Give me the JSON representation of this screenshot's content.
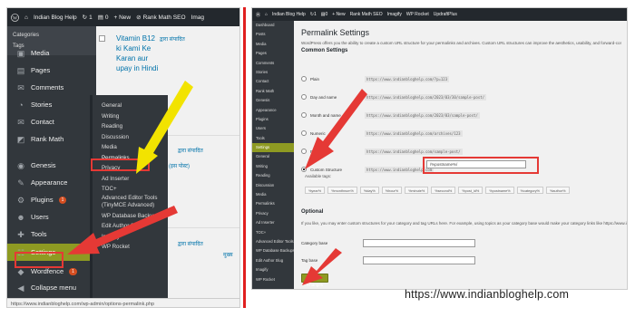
{
  "left": {
    "adminbar": {
      "wp_logo": "wordpress-logo-icon",
      "site_name": "Indian Blog Help",
      "updates_count": "1",
      "comments_count": "0",
      "new_label": "+ New",
      "rankmath_label": "Rank Math SEO",
      "more_label": "Imag"
    },
    "sidebar_top": [
      "Categories",
      "Tags"
    ],
    "menu": [
      {
        "label": "Media",
        "icon": "media-icon"
      },
      {
        "label": "Pages",
        "icon": "pages-icon"
      },
      {
        "label": "Comments",
        "icon": "comments-icon"
      },
      {
        "label": "Stories",
        "icon": "stories-icon"
      },
      {
        "label": "Contact",
        "icon": "contact-icon"
      },
      {
        "label": "Rank Math",
        "icon": "rankmath-icon"
      },
      {
        "label": "Genesis",
        "icon": "genesis-icon"
      },
      {
        "label": "Appearance",
        "icon": "appearance-icon"
      },
      {
        "label": "Plugins",
        "icon": "plugins-icon",
        "badge": "1"
      },
      {
        "label": "Users",
        "icon": "users-icon"
      },
      {
        "label": "Tools",
        "icon": "tools-icon"
      },
      {
        "label": "Settings",
        "icon": "settings-icon",
        "active": true
      },
      {
        "label": "Wordfence",
        "icon": "wordfence-icon",
        "badge": "1"
      },
      {
        "label": "Collapse menu",
        "icon": "collapse-icon"
      }
    ],
    "flyout": [
      "General",
      "Writing",
      "Reading",
      "Discussion",
      "Media",
      "Permalinks",
      "Privacy",
      "Ad Inserter",
      "TOC+",
      "Advanced Editor Tools (TinyMCE Advanced)",
      "WP Database Backups",
      "Edit Author Slug",
      "Imagify",
      "WP Rocket"
    ],
    "posts": {
      "post1_line1": "Vitamin B12",
      "post1_line2": "ki Kami Ke",
      "post1_line3": "Karan aur",
      "post1_line4": "upay in Hindi",
      "hindi1": "द्वारा संपादित",
      "hindi2": "द्वारा संपादित",
      "hindi3": "(इस पोस्ट)",
      "hindi4": "द्वारा संपादित",
      "hindi5": "मुख्य"
    },
    "statusbar": "https://www.indianbloghelp.com/wp-admin/options-permalink.php"
  },
  "right": {
    "adminbar": {
      "site_name": "Indian Blog Help",
      "updates_count": "1",
      "comments_count": "0",
      "new_label": "+ New",
      "rankmath_label": "Rank Math SEO",
      "imagify_label": "Imagify",
      "wprocket_label": "WP Rocket",
      "updraft_label": "UpdraftPlus"
    },
    "sidebar": [
      "Dashboard",
      "Posts",
      "Media",
      "Pages",
      "Comments",
      "Stories",
      "Contact",
      "Rank Math",
      "Genesis",
      "Appearance",
      "Plugins",
      "Users",
      "Tools",
      "Settings",
      "General",
      "Writing",
      "Reading",
      "Discussion",
      "Media",
      "Permalinks",
      "Privacy",
      "Ad Inserter",
      "TOC+",
      "Advanced Editor Tools",
      "WP Database Backups",
      "Edit Author Slug",
      "Imagify",
      "WP Rocket"
    ],
    "title": "Permalink Settings",
    "intro": "WordPress offers you the ability to create a custom URL structure for your permalinks and archives. Custom URL structures can improve the aesthetics, usability, and forward-compatibility of your links.",
    "common_heading": "Common Settings",
    "options": [
      {
        "label": "Plain",
        "code": "https://www.indianbloghelp.com/?p=123"
      },
      {
        "label": "Day and name",
        "code": "https://www.indianbloghelp.com/2023/03/30/sample-post/"
      },
      {
        "label": "Month and name",
        "code": "https://www.indianbloghelp.com/2023/03/sample-post/"
      },
      {
        "label": "Numeric",
        "code": "https://www.indianbloghelp.com/archives/123"
      },
      {
        "label": "Post name",
        "code": "https://www.indianbloghelp.com/sample-post/"
      },
      {
        "label": "Custom Structure",
        "code": "https://www.indianbloghelp.com",
        "selected": true
      }
    ],
    "custom_value": "/%postname%/",
    "available_tags_label": "Available tags:",
    "tags": [
      "%year%",
      "%monthnum%",
      "%day%",
      "%hour%",
      "%minute%",
      "%second%",
      "%post_id%",
      "%postname%",
      "%category%",
      "%author%"
    ],
    "optional_heading": "Optional",
    "optional_intro": "If you like, you may enter custom structures for your category and tag URLs here. For example, using topics as your category base would make your category links like https://www.indianbloghelp.com/topics/uncategorized/",
    "category_base_label": "Category base",
    "tag_base_label": "Tag base",
    "save_label": "Save Changes"
  },
  "footer_url": "https://www.indianbloghelp.com",
  "colors": {
    "highlight_red": "#e53935",
    "arrow_yellow": "#f2e300",
    "active_green": "#8e9a22",
    "admin_dark": "#23282d"
  }
}
